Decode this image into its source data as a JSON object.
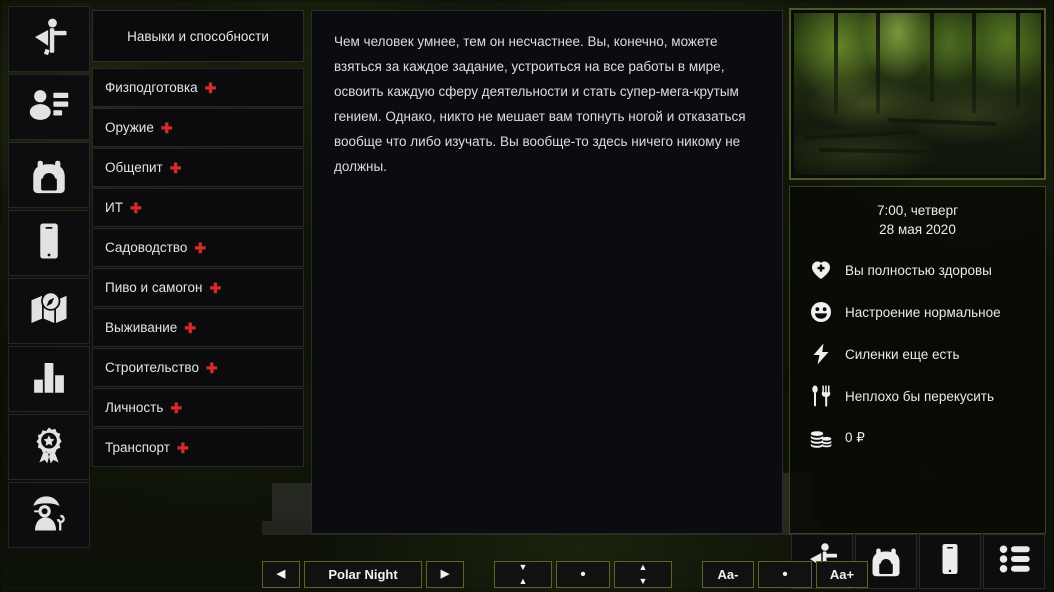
{
  "rail": {
    "items": [
      {
        "name": "character-flag-icon",
        "label": "Персонаж"
      },
      {
        "name": "profile-stats-icon",
        "label": "Профиль"
      },
      {
        "name": "backpack-icon",
        "label": "Инвентарь"
      },
      {
        "name": "phone-icon",
        "label": "Телефон"
      },
      {
        "name": "map-compass-icon",
        "label": "Карта"
      },
      {
        "name": "bar-chart-icon",
        "label": "Навыки"
      },
      {
        "name": "award-ribbon-icon",
        "label": "Достижения"
      },
      {
        "name": "detective-icon",
        "label": "Персона"
      }
    ]
  },
  "skills": {
    "title": "Навыки и способности",
    "plus": "✚",
    "items": [
      {
        "label": "Физподготовка"
      },
      {
        "label": "Оружие"
      },
      {
        "label": "Общепит"
      },
      {
        "label": "ИТ"
      },
      {
        "label": "Садоводство"
      },
      {
        "label": "Пиво и самогон"
      },
      {
        "label": "Выживание"
      },
      {
        "label": "Строительство"
      },
      {
        "label": "Личность"
      },
      {
        "label": "Транспорт"
      }
    ]
  },
  "main": {
    "body": "Чем человек умнее, тем он несчастнее. Вы, конечно, можете взяться за каждое задание, устроиться на все работы в мире, освоить каждую сферу деятельности и стать супер-мега-крутым гением. Однако, никто не мешает вам топнуть ногой и отказаться вообще что либо изучать. Вы вообще-то здесь ничего никому не должны."
  },
  "status": {
    "time": "7:00, четверг",
    "date": "28 мая 2020",
    "rows": [
      {
        "icon": "heart-health-icon",
        "text": "Вы полностью здоровы"
      },
      {
        "icon": "smiley-mood-icon",
        "text": "Настроение нормальное"
      },
      {
        "icon": "lightning-energy-icon",
        "text": "Силенки еще есть"
      },
      {
        "icon": "fork-spoon-hunger-icon",
        "text": "Неплохо бы перекусить"
      },
      {
        "icon": "coins-money-icon",
        "text": "0 ₽"
      }
    ]
  },
  "quickbar": {
    "items": [
      {
        "name": "character-flag-icon",
        "label": "Персонаж"
      },
      {
        "name": "backpack-icon",
        "label": "Инвентарь"
      },
      {
        "name": "phone-icon",
        "label": "Телефон"
      },
      {
        "name": "list-menu-icon",
        "label": "Меню"
      }
    ]
  },
  "toolbar": {
    "prev": "◀",
    "theme": "Polar Night",
    "next": "▶",
    "shrink_top": "▼",
    "shrink_bottom": "▲",
    "line_dot": "•",
    "grow_top": "▲",
    "grow_bottom": "▼",
    "font_smaller": "Aa-",
    "font_dot": "•",
    "font_bigger": "Aa+"
  },
  "colors": {
    "accent_border": "#5d6429",
    "plus_red": "#d32b2b",
    "panel_bg": "#0b0c10",
    "text": "#e4e4e4"
  }
}
